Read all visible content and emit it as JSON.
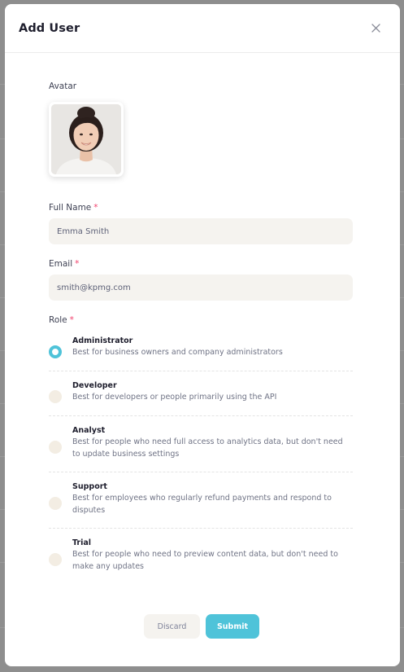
{
  "modal": {
    "title": "Add User",
    "close_icon": "close-icon"
  },
  "form": {
    "avatar_label": "Avatar",
    "full_name_label": "Full Name",
    "full_name_value": "Emma Smith",
    "email_label": "Email",
    "email_value": "smith@kpmg.com",
    "role_label": "Role",
    "required_mark": "*"
  },
  "roles": [
    {
      "title": "Administrator",
      "desc": "Best for business owners and company administrators",
      "selected": true
    },
    {
      "title": "Developer",
      "desc": "Best for developers or people primarily using the API",
      "selected": false
    },
    {
      "title": "Analyst",
      "desc": "Best for people who need full access to analytics data, but don't need to update business settings",
      "selected": false
    },
    {
      "title": "Support",
      "desc": "Best for employees who regularly refund payments and respond to disputes",
      "selected": false
    },
    {
      "title": "Trial",
      "desc": "Best for people who need to preview content data, but don't need to make any updates",
      "selected": false
    }
  ],
  "actions": {
    "discard_label": "Discard",
    "submit_label": "Submit"
  },
  "colors": {
    "accent": "#4fc3d9",
    "required": "#f1416c",
    "input_bg": "#f5f3ef"
  }
}
